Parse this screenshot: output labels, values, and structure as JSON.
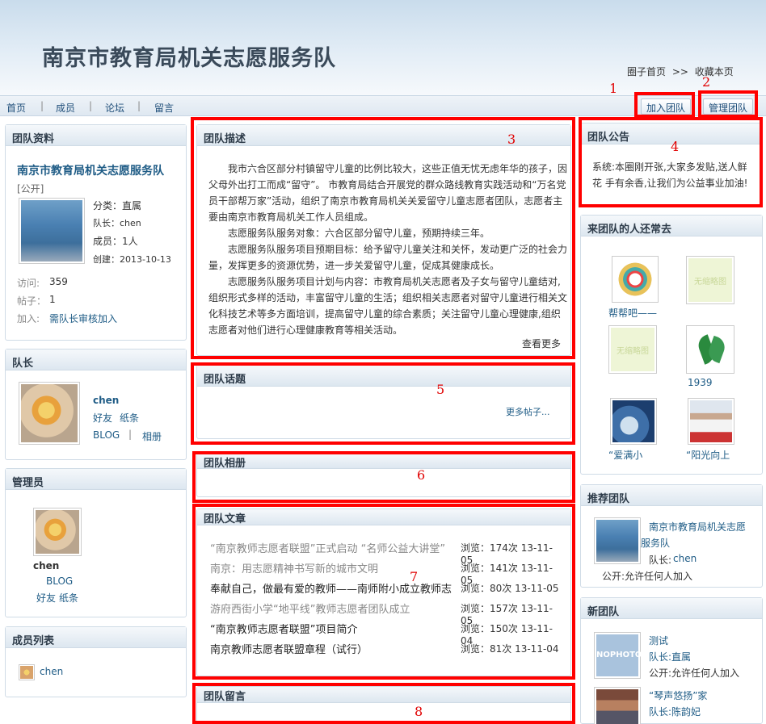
{
  "header": {
    "title": "南京市教育局机关志愿服务队",
    "links": [
      "圈子首页",
      ">>",
      "收藏本页"
    ]
  },
  "nav": {
    "items": [
      "首页",
      "成员",
      "论坛",
      "留言"
    ],
    "separator": "|",
    "join_button": "加入团队",
    "manage_button": "管理团队"
  },
  "markers": [
    "1",
    "2",
    "3",
    "4",
    "5",
    "6",
    "7",
    "8"
  ],
  "team_info": {
    "heading": "团队资料",
    "name": "南京市教育局机关志愿服务队",
    "visibility": "[公开]",
    "category": "分类：直属",
    "leader": "队长：chen",
    "members": "成员：1人",
    "created": "创建：2013-10-13",
    "visits_label": "访问:",
    "visits_value": "359",
    "posts_label": "帖子：",
    "posts_value": "1",
    "join_label": "加入:",
    "join_value": "需队长审核加入"
  },
  "leader_box": {
    "heading": "队长",
    "name": "chen",
    "friend": "好友",
    "note": "纸条",
    "blog": "BLOG",
    "sep": "|",
    "album": "相册"
  },
  "admin_box": {
    "heading": "管理员",
    "name": "chen",
    "blog": "BLOG",
    "friend": "好友",
    "note": "纸条"
  },
  "member_list": {
    "heading": "成员列表",
    "member": "chen"
  },
  "description": {
    "heading": "团队描述",
    "paragraphs": [
      "我市六合区部分村镇留守儿童的比例比较大，这些正值无忧无虑年华的孩子，因父母外出打工而成“留守”。 市教育局结合开展党的群众路线教育实践活动和“万名党员干部帮万家”活动，组织了南京市教育局机关关爱留守儿童志愿者团队，志愿者主要由南京市教育局机关工作人员组成。",
      "志愿服务队服务对象：六合区部分留守儿童，预期持续三年。",
      "志愿服务队服务项目预期目标：给予留守儿童关注和关怀，发动更广泛的社会力量，发挥更多的资源优势，进一步关爱留守儿童，促成其健康成长。",
      "志愿服务队服务项目计划与内容：市教育局机关志愿者及子女与留守儿童结对,组织形式多样的活动，丰富留守儿童的生活；组织相关志愿者对留守儿童进行相关文化科技艺术等多方面培训，提高留守儿童的综合素质；关注留守儿童心理健康,组织志愿者对他们进行心理健康教育等相关活动。"
    ],
    "more": "查看更多"
  },
  "topics": {
    "heading": "团队话题",
    "more": "更多帖子..."
  },
  "album": {
    "heading": "团队相册"
  },
  "articles": {
    "heading": "团队文章",
    "rows": [
      {
        "title": "“南京教师志愿者联盟”正式启动 “名师公益大讲堂”",
        "views": "浏览：174次 13-11-05",
        "color": "#888888"
      },
      {
        "title": "南京：用志愿精神书写新的城市文明",
        "views": "浏览：141次 13-11-05",
        "color": "#888888"
      },
      {
        "title": "奉献自己，做最有爱的教师——南师附小成立教师志",
        "views": "浏览：80次 13-11-05",
        "color": "#222222"
      },
      {
        "title": "游府西街小学“地平线”教师志愿者团队成立",
        "views": "浏览：157次 13-11-05",
        "color": "#888888"
      },
      {
        "title": "“南京教师志愿者联盟”项目简介",
        "views": "浏览：150次 13-11-04",
        "color": "#222222"
      },
      {
        "title": "南京教师志愿者联盟章程（试行）",
        "views": "浏览：81次 13-11-04",
        "color": "#222222"
      }
    ]
  },
  "messages": {
    "heading": "团队留言"
  },
  "announcement": {
    "heading": "团队公告",
    "text": "系统:本圈刚开张,大家多发贴,送人鲜花 手有余香,让我们为公益事业加油!"
  },
  "visitors": {
    "heading": "来团队的人还常去",
    "items": [
      {
        "label": "帮帮吧——",
        "icon": "badge-thumbnail"
      },
      {
        "label": "",
        "icon": "no-thumbnail"
      },
      {
        "label": "",
        "icon": "no-thumbnail"
      },
      {
        "label": "1939",
        "icon": "leaf-logo-thumbnail"
      },
      {
        "label": "“爱满小",
        "icon": "mouse-thumbnail"
      },
      {
        "label": "“阳光向上",
        "icon": "person-thumbnail"
      }
    ],
    "placeholder_text": "无缩略图"
  },
  "recommended": {
    "heading": "推荐团队",
    "name": "南京市教育局机关志愿服务队",
    "leader_label": "队长:",
    "leader_name": "chen",
    "policy": "公开:允许任何人加入"
  },
  "new_teams": {
    "heading": "新团队",
    "items": [
      {
        "name": "测试",
        "leader": "队长:直属",
        "policy": "公开:允许任何人加入",
        "thumb": "NOPHOTO"
      },
      {
        "name": "“琴声悠扬”家",
        "leader": "队长:陈韵妃",
        "policy": "",
        "thumb": ""
      }
    ]
  },
  "colors": {
    "link": "#1f5c86",
    "highlight": "#ff0000"
  }
}
